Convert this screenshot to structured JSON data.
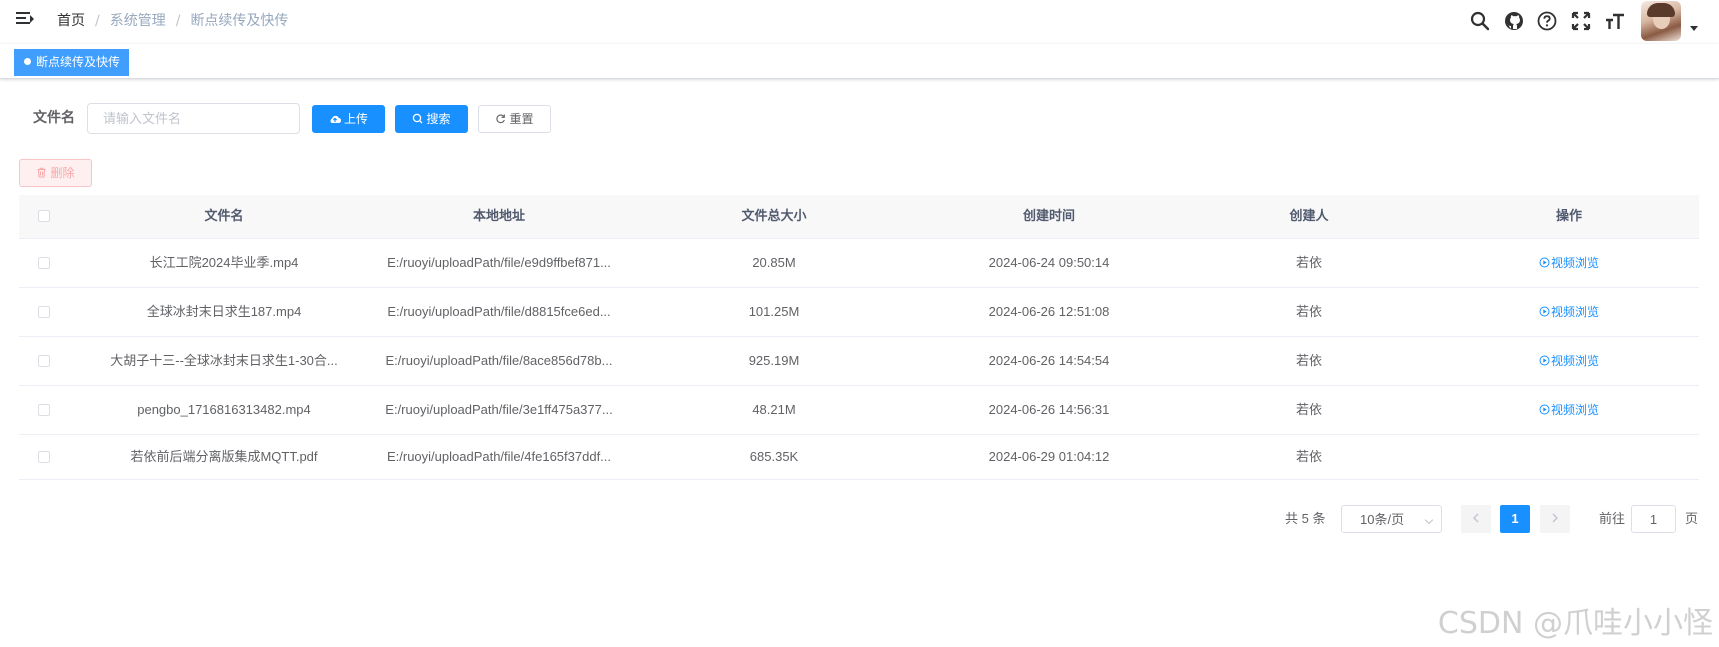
{
  "breadcrumb": [
    "首页",
    "系统管理",
    "断点续传及快传"
  ],
  "tags": {
    "active_label": "断点续传及快传"
  },
  "search": {
    "label": "文件名",
    "placeholder": "请输入文件名",
    "upload_label": "上传",
    "search_label": "搜索",
    "reset_label": "重置"
  },
  "toolbar": {
    "delete_label": "删除"
  },
  "table": {
    "headers": [
      "文件名",
      "本地地址",
      "文件总大小",
      "创建时间",
      "创建人",
      "操作"
    ],
    "rows": [
      {
        "name": "长江工院2024毕业季.mp4",
        "path": "E:/ruoyi/uploadPath/file/e9d9ffbef871...",
        "size": "20.85M",
        "created": "2024-06-24 09:50:14",
        "creator": "若依",
        "action": "视频浏览"
      },
      {
        "name": "全球冰封末日求生187.mp4",
        "path": "E:/ruoyi/uploadPath/file/d8815fce6ed...",
        "size": "101.25M",
        "created": "2024-06-26 12:51:08",
        "creator": "若依",
        "action": "视频浏览"
      },
      {
        "name": "大胡子十三--全球冰封末日求生1-30合...",
        "path": "E:/ruoyi/uploadPath/file/8ace856d78b...",
        "size": "925.19M",
        "created": "2024-06-26 14:54:54",
        "creator": "若依",
        "action": "视频浏览"
      },
      {
        "name": "pengbo_1716816313482.mp4",
        "path": "E:/ruoyi/uploadPath/file/3e1ff475a377...",
        "size": "48.21M",
        "created": "2024-06-26 14:56:31",
        "creator": "若依",
        "action": "视频浏览"
      },
      {
        "name": "若依前后端分离版集成MQTT.pdf",
        "path": "E:/ruoyi/uploadPath/file/4fe165f37ddf...",
        "size": "685.35K",
        "created": "2024-06-29 01:04:12",
        "creator": "若依",
        "action": ""
      }
    ]
  },
  "pagination": {
    "total": "共 5 条",
    "page_size": "10条/页",
    "current_page": "1",
    "goto_label": "前往",
    "goto_value": "1",
    "goto_suffix": "页"
  },
  "watermark": "CSDN @爪哇小小怪",
  "colors": {
    "primary": "#1890ff",
    "danger_plain_bg": "#fef0f0",
    "header_bg": "#f8f8f9"
  },
  "icons": [
    "hamburger-icon",
    "search-icon",
    "github-icon",
    "help-icon",
    "fullscreen-icon",
    "font-size-icon",
    "upload-cloud-icon",
    "search-btn-icon",
    "refresh-icon",
    "delete-icon",
    "play-circle-icon"
  ]
}
